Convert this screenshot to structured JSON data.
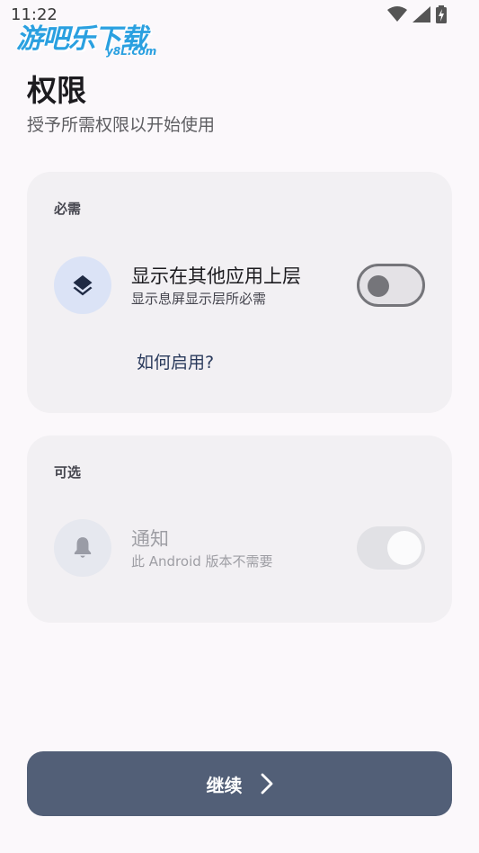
{
  "status_bar": {
    "time": "11:22",
    "icons": [
      "wifi-icon",
      "signal-icon",
      "battery-charging-icon"
    ]
  },
  "watermark": {
    "main": "游吧乐下载",
    "sub": "y8L.com",
    "color": "#2aa0e0"
  },
  "header": {
    "title": "权限",
    "subtitle": "授予所需权限以开始使用"
  },
  "required": {
    "label": "必需",
    "permission": {
      "icon": "layers-icon",
      "title": "显示在其他应用上层",
      "description": "显示息屏显示层所必需",
      "toggle": "off"
    },
    "help_link": "如何启用?"
  },
  "optional": {
    "label": "可选",
    "permission": {
      "icon": "bell-icon",
      "title": "通知",
      "description": "此 Android 版本不需要",
      "toggle": "on-disabled"
    }
  },
  "footer": {
    "continue_label": "继续",
    "continue_icon": "chevron-right-icon"
  },
  "colors": {
    "background": "#fbf8fb",
    "card": "#f2f0f3",
    "icon_circle": "#dbe3f6",
    "button": "#525f77"
  }
}
